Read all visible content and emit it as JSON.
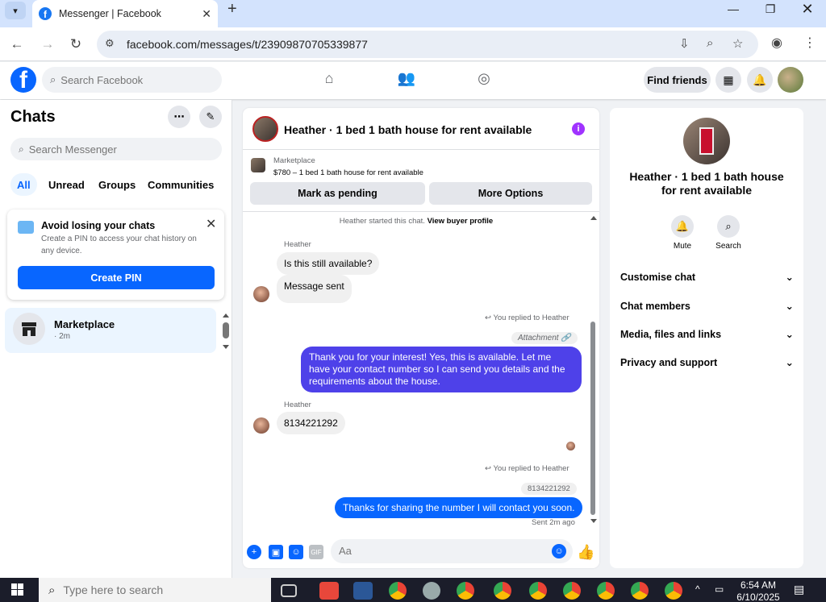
{
  "browser": {
    "tab_title": "Messenger | Facebook",
    "url": "facebook.com/messages/t/23909870705339877"
  },
  "fb": {
    "logo": "f",
    "search_placeholder": "Search Facebook",
    "find_friends": "Find friends"
  },
  "left": {
    "title": "Chats",
    "search_placeholder": "Search Messenger",
    "filters": [
      "All",
      "Unread",
      "Groups",
      "Communities"
    ],
    "pin_card": {
      "title": "Avoid losing your chats",
      "desc": "Create a PIN to access your chat history on any device.",
      "button": "Create PIN"
    },
    "chat_item": {
      "name": "Marketplace",
      "time": "· 2m"
    }
  },
  "chat": {
    "title": "Heather · 1 bed 1 bath house for rent available",
    "marketplace_label": "Marketplace",
    "listing": "$780 – 1 bed 1 bath house for rent available",
    "btn_pending": "Mark as pending",
    "btn_more": "More Options",
    "system_msg": "Heather started this chat.",
    "system_link": "View buyer profile",
    "sender": "Heather",
    "msg1": "Is this still available?",
    "msg2": "Message sent",
    "reply_label": "You replied to Heather",
    "attachment": "Attachment",
    "msg3": "Thank you for your interest! Yes, this is available. Let me have your contact number so I can send you details and the requirements about the house.",
    "msg4": "8134221292",
    "quote": "8134221292",
    "msg5": "Thanks for sharing the number I will contact you soon.",
    "sent_status": "Sent 2m ago",
    "input_placeholder": "Aa"
  },
  "right": {
    "title": "Heather · 1 bed 1 bath house for rent available",
    "mute": "Mute",
    "search": "Search",
    "sections": [
      "Customise chat",
      "Chat members",
      "Media, files and links",
      "Privacy and support"
    ]
  },
  "taskbar": {
    "search_placeholder": "Type here to search",
    "time": "6:54 AM",
    "date": "6/10/2025"
  }
}
